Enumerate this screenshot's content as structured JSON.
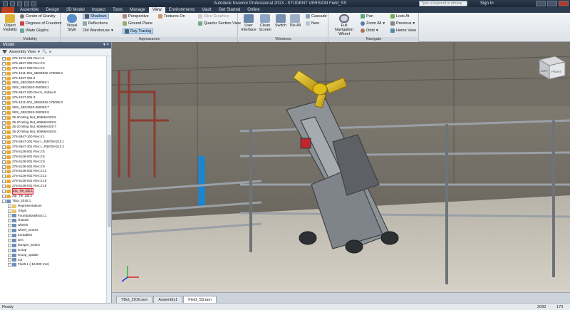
{
  "window": {
    "title": "Autodesk Inventor Professional 2013 - STUDENT VERSION    Field_SS",
    "search_placeholder": "Type a keyword or phrase",
    "sign_in": "Sign In"
  },
  "tabs": [
    "Assemble",
    "Design",
    "3D Model",
    "Inspect",
    "Tools",
    "Manage",
    "View",
    "Environments",
    "Vault",
    "Get Started",
    "Online"
  ],
  "active_tab": "View",
  "ribbon": {
    "visibility": {
      "title": "Visibility",
      "object_visibility": "Object Visibility",
      "center_of_gravity": "Center of Gravity",
      "degrees_of_freedom": "Degrees of Freedom",
      "ilmate_glyphs": "iMate Glyphs"
    },
    "appearance": {
      "title": "Appearance",
      "visual_style": "Visual Style",
      "shadows": "Shadows",
      "reflections": "Reflections",
      "lighting": "Old Warehouse",
      "perspective": "Perspective",
      "ground_plane": "Ground Plane",
      "ray_tracing": "Ray Tracing",
      "textures_on": "Textures On",
      "slice_graphics": "Slice Graphics",
      "quarter_section_view": "Quarter Section View"
    },
    "windows": {
      "title": "Windows",
      "user_interface": "User Interface",
      "clean_screen": "Clean Screen",
      "switch": "Switch",
      "tile_all": "Tile All",
      "cascade": "Cascade",
      "new": "New"
    },
    "navigate": {
      "title": "Navigate",
      "full_navigation_wheel": "Full Navigation Wheel",
      "pan": "Pan",
      "zoom_all": "Zoom All",
      "orbit": "Orbit",
      "look_at": "Look At",
      "previous": "Previous",
      "home_view": "Home View"
    }
  },
  "browser": {
    "title": "Model",
    "view_dropdown": "Assembly View",
    "items": [
      {
        "label": "276-1572-001 Rev:1:1",
        "type": "part",
        "depth": 0
      },
      {
        "label": "276-4847-009 Rev:2:3",
        "type": "part",
        "depth": 0
      },
      {
        "label": "276-4847-009 Rev:2:4",
        "type": "part",
        "depth": 0
      },
      {
        "label": "276-1011-001_SBS5832-175055:2",
        "type": "part",
        "depth": 0
      },
      {
        "label": "276-1027-001:2",
        "type": "part",
        "depth": 0
      },
      {
        "label": "SBS_SBS2520-050055:1",
        "type": "part",
        "depth": 0
      },
      {
        "label": "SBS_SBS2520-050055:2",
        "type": "part",
        "depth": 0
      },
      {
        "label": "276-4847-030 Rev:5_Yellow:6",
        "type": "part",
        "depth": 0
      },
      {
        "label": "276-1027-001:3",
        "type": "part",
        "depth": 0
      },
      {
        "label": "276-1011-001_SBS5832-175055:3",
        "type": "part",
        "depth": 0
      },
      {
        "label": "SBS_SBS2520-050055:7",
        "type": "part",
        "depth": 0
      },
      {
        "label": "SBS_SBS2520-050055:8",
        "type": "part",
        "depth": 0
      },
      {
        "label": "25-20 Wing Nut_90866A029:5",
        "type": "part",
        "depth": 0
      },
      {
        "label": "25-20 Wing Nut_90866A029:6",
        "type": "part",
        "depth": 0
      },
      {
        "label": "25-20 Wing Nut_90866A029:7",
        "type": "part",
        "depth": 0
      },
      {
        "label": "25-20 Wing Nut_90866A029:8",
        "type": "part",
        "depth": 0
      },
      {
        "label": "276-4847-100 Rev:4:1",
        "type": "part",
        "depth": 0
      },
      {
        "label": "276-4847-301 Rev:1_R387BA213:1",
        "type": "part",
        "depth": 0
      },
      {
        "label": "276-4847-301 Rev:1_R387BA213:2",
        "type": "part",
        "depth": 0
      },
      {
        "label": "276-5136-001 Rev:2:5",
        "type": "part",
        "depth": 0
      },
      {
        "label": "276-5136-001 Rev:2:6",
        "type": "part",
        "depth": 0
      },
      {
        "label": "276-5136-001 Rev:2:8",
        "type": "part",
        "depth": 0
      },
      {
        "label": "276-5136-001 Rev:2:9",
        "type": "part",
        "depth": 0
      },
      {
        "label": "276-5136-001 Rev:2:12",
        "type": "part",
        "depth": 0
      },
      {
        "label": "276-5136-001 Rev:2:13",
        "type": "part",
        "depth": 0
      },
      {
        "label": "276-5136-001 Rev:2:15",
        "type": "part",
        "depth": 0
      },
      {
        "label": "276-5136-001 Rev:2:16",
        "type": "part",
        "depth": 0
      },
      {
        "label": "Zip_Tie_Zip:1",
        "type": "part",
        "depth": 0,
        "selected": true
      },
      {
        "label": "Zip_Tie_Zip:2",
        "type": "part",
        "depth": 0
      },
      {
        "label": "TBot_2016:1",
        "type": "sub",
        "depth": 0
      },
      {
        "label": "Representations",
        "type": "folder",
        "depth": 1
      },
      {
        "label": "Origin",
        "type": "folder",
        "depth": 1
      },
      {
        "label": "FoundationBlock1:1",
        "type": "sub",
        "depth": 1
      },
      {
        "label": "chassis",
        "type": "sub",
        "depth": 1
      },
      {
        "label": "wheels",
        "type": "sub",
        "depth": 1
      },
      {
        "label": "wheel_motors",
        "type": "sub",
        "depth": 1
      },
      {
        "label": "turntables",
        "type": "sub",
        "depth": 1
      },
      {
        "label": "arm",
        "type": "sub",
        "depth": 1
      },
      {
        "label": "bumper_switch",
        "type": "sub",
        "depth": 1
      },
      {
        "label": "scoop",
        "type": "sub",
        "depth": 1
      },
      {
        "label": "scoop_update",
        "type": "sub",
        "depth": 1
      },
      {
        "label": "icd",
        "type": "sub",
        "depth": 1
      },
      {
        "label": "Flush:1 (-16.000 mm)",
        "type": "sub",
        "depth": 1
      }
    ]
  },
  "viewcube": {
    "label_left": "LEFT",
    "label_front": "FRONT"
  },
  "doc_tabs": [
    "TBot_2016.iam",
    "Assembly1",
    "Field_SS.iam"
  ],
  "active_doc_tab": "Field_SS.iam",
  "status": {
    "ready": "Ready",
    "count1": "2093",
    "count2": "170"
  },
  "colors": {
    "accent": "#bcd7f3",
    "ribbon_bg": "#e6eaee",
    "tab_bar": "#2d3b4f",
    "cone_yellow": "#e9c21a"
  }
}
